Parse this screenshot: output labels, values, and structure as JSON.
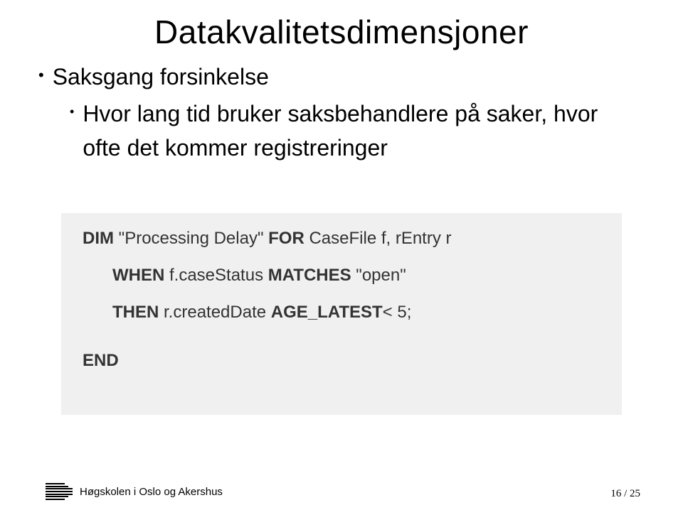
{
  "title": "Datakvalitetsdimensjoner",
  "bullets": {
    "level1": "Saksgang forsinkelse",
    "level2": "Hvor lang tid bruker saksbehandlere på saker, hvor ofte det kommer registreringer"
  },
  "code": {
    "kw_dim": "DIM",
    "dim_name": " \"Processing Delay\" ",
    "kw_for": "FOR",
    "for_args": " CaseFile f, rEntry r",
    "kw_when": "WHEN",
    "when_expr": " f.caseStatus ",
    "kw_matches": "MATCHES",
    "matches_arg": " \"open\"",
    "kw_then": "THEN",
    "then_expr": " r.createdDate ",
    "kw_age": "AGE_LATEST",
    "age_arg": "< 5;",
    "kw_end": "END"
  },
  "footer": {
    "institution": "Høgskolen i Oslo og Akershus",
    "page": "16 / 25"
  }
}
